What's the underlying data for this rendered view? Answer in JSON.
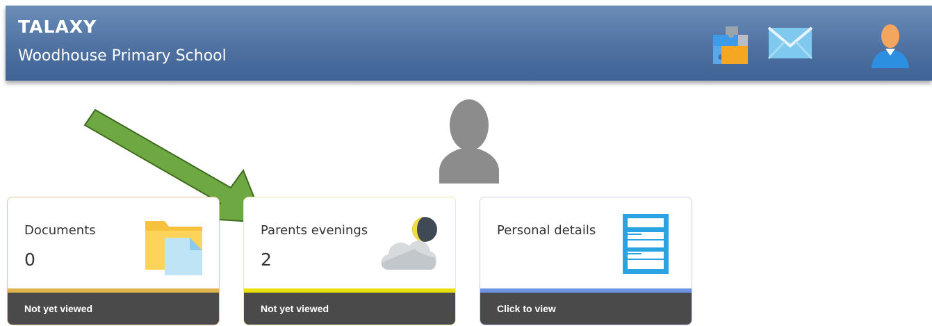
{
  "header": {
    "brand": "TALAXY",
    "school": "Woodhouse Primary School",
    "icons": [
      "puzzle-icon",
      "mail-icon",
      "user-icon"
    ]
  },
  "tiles": [
    {
      "title": "Documents",
      "count": "0",
      "footer": "Not yet viewed",
      "icon": "folder-document-icon",
      "border_color": "#e4c893",
      "stripe_color": "#e0b44c"
    },
    {
      "title": "Parents evenings",
      "count": "2",
      "footer": "Not yet viewed",
      "icon": "weather-cloud-moon-icon",
      "border_color": "#f3eba5",
      "stripe_color": "#eadf0c"
    },
    {
      "title": "Personal details",
      "count": "",
      "footer": "Click to view",
      "icon": "document-list-icon",
      "border_color": "#c8d3ef",
      "stripe_color": "#6d93e3"
    }
  ],
  "colors": {
    "header_top": "#6c8db8",
    "header_bottom": "#3f6395",
    "footer_bg": "#4a4a4a",
    "arrow": "#6ea842"
  }
}
